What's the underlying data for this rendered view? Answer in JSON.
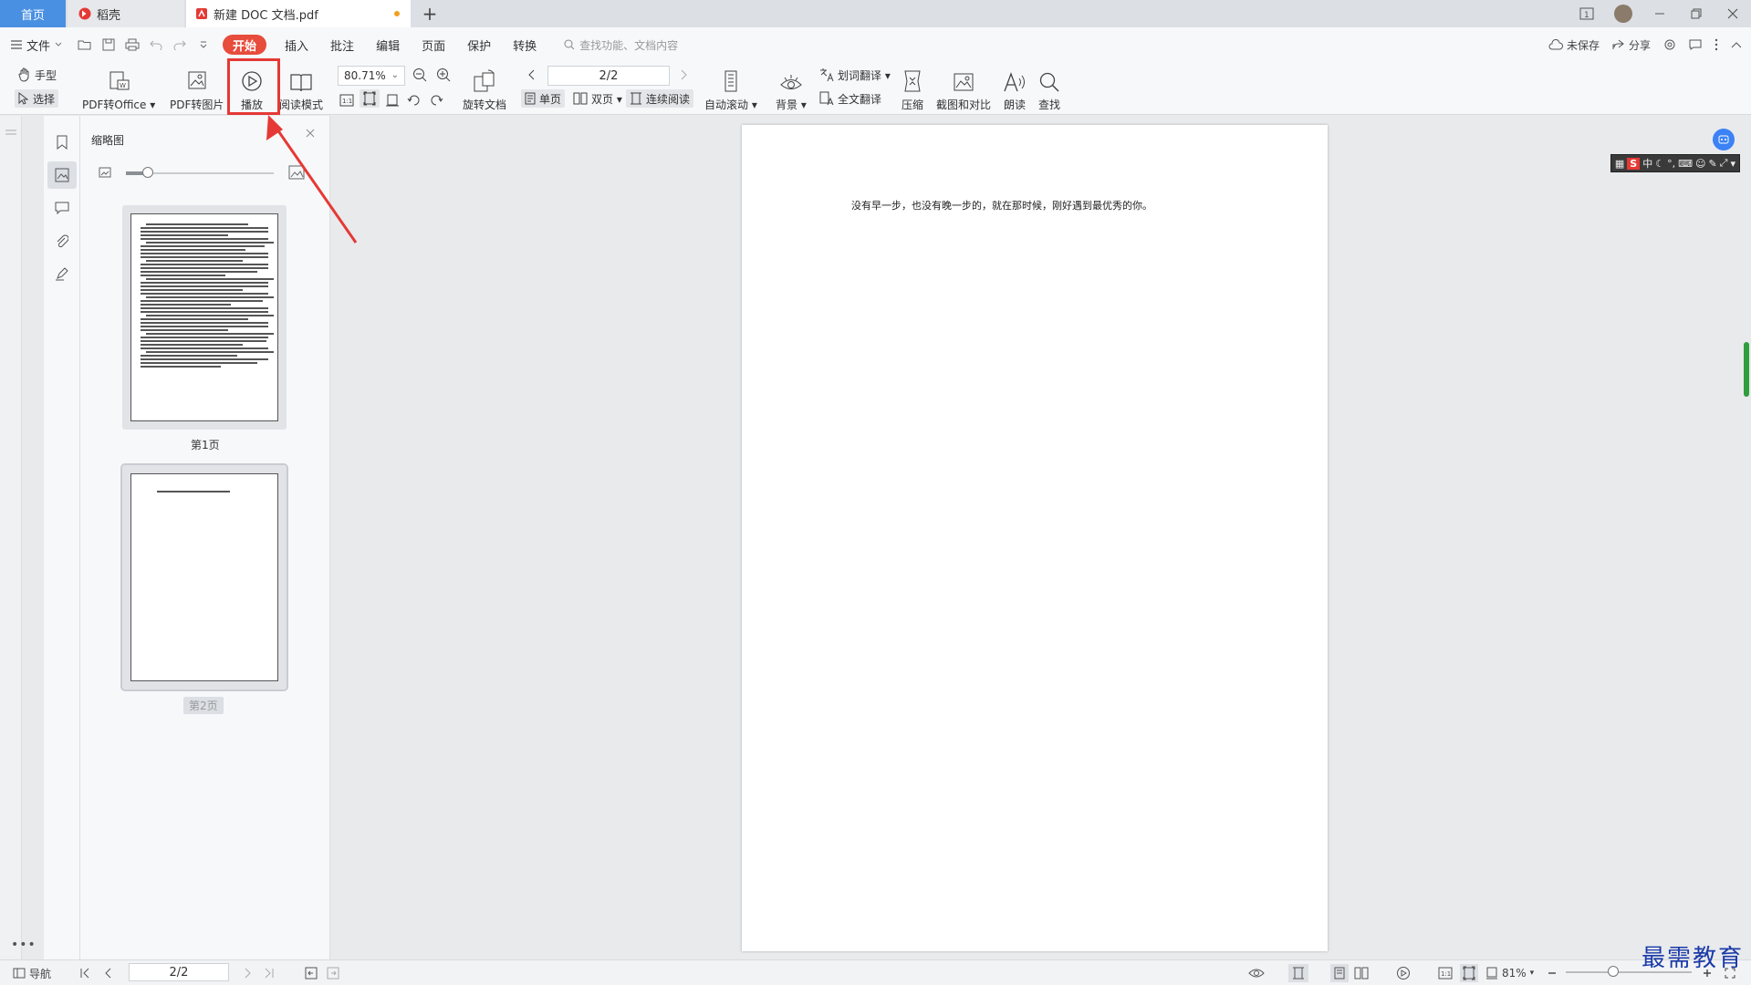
{
  "tabs": {
    "home": "首页",
    "daoke": "稻壳",
    "doc": "新建 DOC 文档.pdf",
    "new_tab": "+"
  },
  "menu": {
    "file": "文件",
    "start": "开始",
    "insert": "插入",
    "annotate": "批注",
    "edit": "编辑",
    "page": "页面",
    "protect": "保护",
    "convert": "转换",
    "search_placeholder": "查找功能、文档内容",
    "unsaved": "未保存",
    "share": "分享"
  },
  "ribbon": {
    "hand": "手型",
    "select": "选择",
    "pdf_to_office": "PDF转Office",
    "pdf_to_image": "PDF转图片",
    "play": "播放",
    "read_mode": "阅读模式",
    "zoom": "80.71%",
    "rotate_doc": "旋转文档",
    "page_number": "2/2",
    "single_page": "单页",
    "double_page": "双页",
    "continuous": "连续阅读",
    "auto_scroll": "自动滚动",
    "background": "背景",
    "word_translate": "划词翻译",
    "full_translate": "全文翻译",
    "compress": "压缩",
    "screenshot_compare": "截图和对比",
    "read_aloud": "朗读",
    "find": "查找"
  },
  "thumbnails": {
    "title": "缩略图",
    "slider_value": 0.15,
    "pages": [
      {
        "label": "第1页"
      },
      {
        "label": "第2页"
      }
    ]
  },
  "document": {
    "text": "没有早一步，也没有晚一步的，就在那时候，刚好遇到最优秀的你。"
  },
  "ime": {
    "mode": "中"
  },
  "status": {
    "nav": "导航",
    "page_number": "2/2",
    "zoom": "81%",
    "zoom_level": 0.38
  },
  "watermark": "最需教育",
  "colors": {
    "accent_blue": "#4a90e2",
    "start_red": "#e74c3c",
    "highlight_red": "#e53935",
    "scroll_green": "#2e9e3e",
    "watermark_blue": "#1a3aa8"
  }
}
